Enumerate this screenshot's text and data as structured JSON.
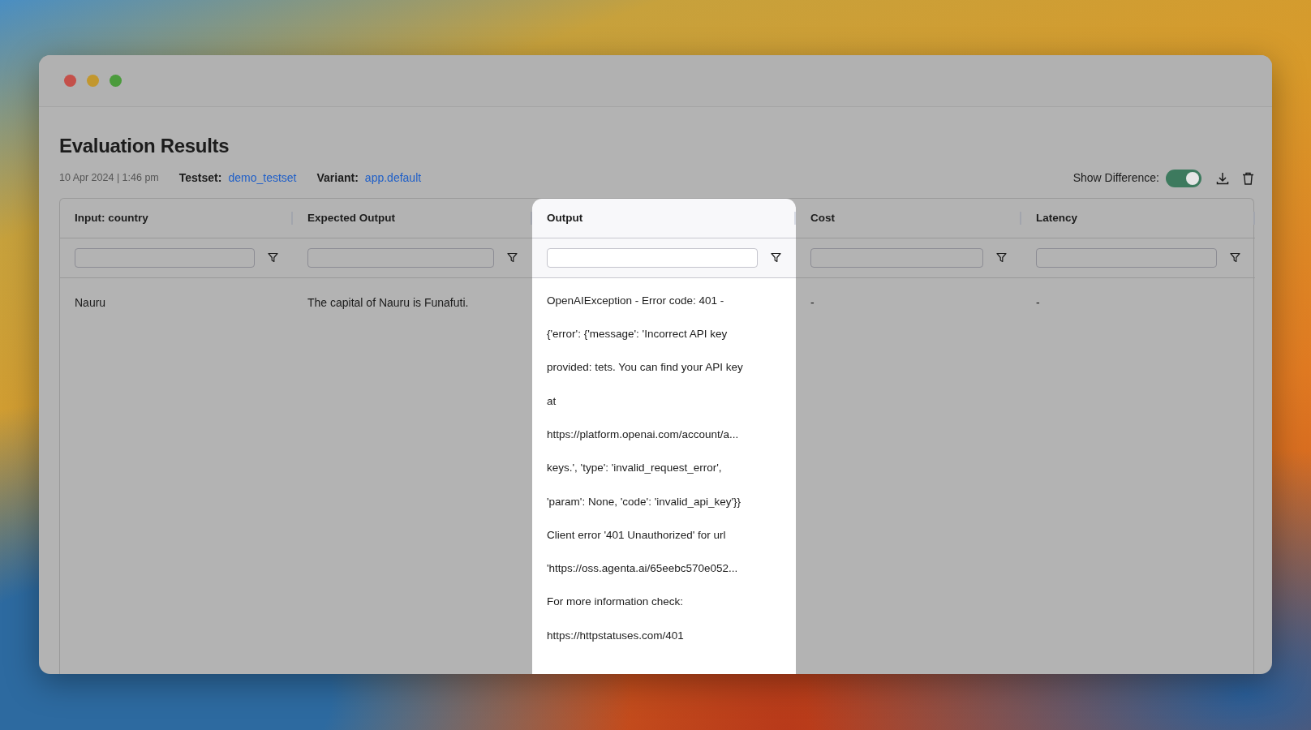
{
  "page": {
    "title": "Evaluation Results",
    "date": "10 Apr 2024 | 1:46 pm",
    "testset_label": "Testset:",
    "testset": "demo_testset",
    "variant_label": "Variant:",
    "variant": "app.default",
    "show_difference": {
      "label": "Show Difference:",
      "on": true
    }
  },
  "table": {
    "columns": [
      {
        "label": "Input: country",
        "highlighted": false
      },
      {
        "label": "Expected Output",
        "highlighted": false
      },
      {
        "label": "Output",
        "highlighted": true
      },
      {
        "label": "Cost",
        "highlighted": false
      },
      {
        "label": "Latency",
        "highlighted": false
      }
    ],
    "rows": [
      {
        "cells": [
          {
            "text": "Nauru"
          },
          {
            "text": "The capital of Nauru is Funafuti."
          },
          {
            "lines": [
              "OpenAIException - Error code: 401 -",
              "{'error': {'message': 'Incorrect API key",
              "provided: tets. You can find your API key",
              "at",
              "https://platform.openai.com/account/a...",
              "keys.', 'type': 'invalid_request_error',",
              "'param': None, 'code': 'invalid_api_key'}}",
              "Client error '401 Unauthorized' for url",
              "'https://oss.agenta.ai/65eebc570e052...",
              "For more information check:",
              "https://httpstatuses.com/401"
            ]
          },
          {
            "text": "-"
          },
          {
            "text": "-"
          }
        ]
      }
    ]
  }
}
